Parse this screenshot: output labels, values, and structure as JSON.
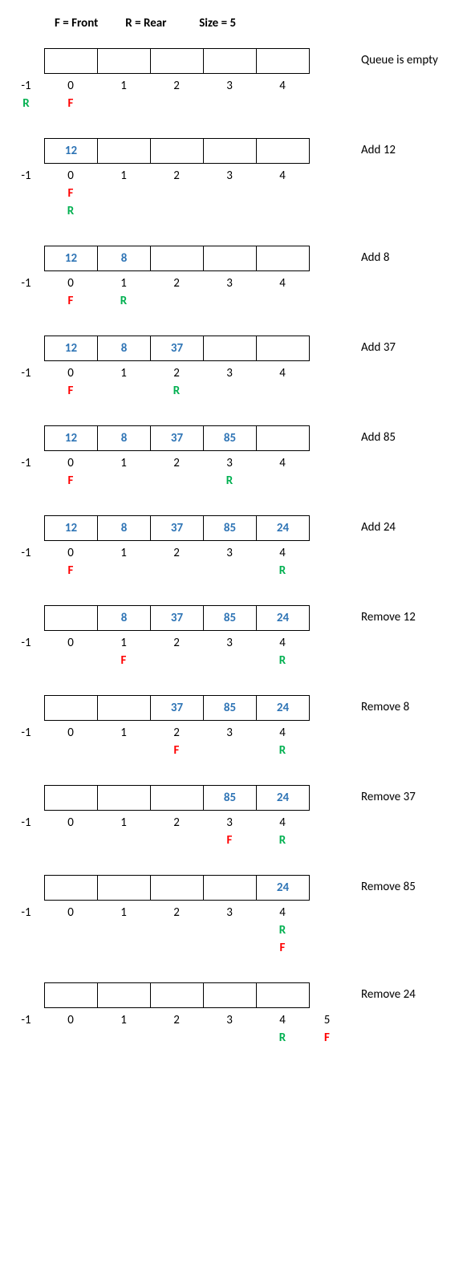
{
  "legend": {
    "front": "F = Front",
    "rear": "R = Rear",
    "size": "Size = 5"
  },
  "pre_index": "-1",
  "post_index": "5",
  "indices": [
    "0",
    "1",
    "2",
    "3",
    "4"
  ],
  "F": "F",
  "R": "R",
  "states": [
    {
      "caption": "Queue is empty",
      "cells": [
        "",
        "",
        "",
        "",
        ""
      ],
      "ptrRows": [
        {
          "pre": "R",
          "cols": [
            "F",
            "",
            "",
            "",
            ""
          ],
          "post": ""
        }
      ]
    },
    {
      "caption": "Add 12",
      "cells": [
        "12",
        "",
        "",
        "",
        ""
      ],
      "ptrRows": [
        {
          "pre": "",
          "cols": [
            "F",
            "",
            "",
            "",
            ""
          ],
          "post": ""
        },
        {
          "pre": "",
          "cols": [
            "R",
            "",
            "",
            "",
            ""
          ],
          "post": ""
        }
      ]
    },
    {
      "caption": "Add 8",
      "cells": [
        "12",
        "8",
        "",
        "",
        ""
      ],
      "ptrRows": [
        {
          "pre": "",
          "cols": [
            "F",
            "R",
            "",
            "",
            ""
          ],
          "post": ""
        }
      ]
    },
    {
      "caption": "Add 37",
      "cells": [
        "12",
        "8",
        "37",
        "",
        ""
      ],
      "ptrRows": [
        {
          "pre": "",
          "cols": [
            "F",
            "",
            "R",
            "",
            ""
          ],
          "post": ""
        }
      ]
    },
    {
      "caption": "Add 85",
      "cells": [
        "12",
        "8",
        "37",
        "85",
        ""
      ],
      "ptrRows": [
        {
          "pre": "",
          "cols": [
            "F",
            "",
            "",
            "R",
            ""
          ],
          "post": ""
        }
      ]
    },
    {
      "caption": "Add 24",
      "cells": [
        "12",
        "8",
        "37",
        "85",
        "24"
      ],
      "ptrRows": [
        {
          "pre": "",
          "cols": [
            "F",
            "",
            "",
            "",
            "R"
          ],
          "post": ""
        }
      ]
    },
    {
      "caption": "Remove 12",
      "cells": [
        "",
        "8",
        "37",
        "85",
        "24"
      ],
      "ptrRows": [
        {
          "pre": "",
          "cols": [
            "",
            "F",
            "",
            "",
            "R"
          ],
          "post": ""
        }
      ]
    },
    {
      "caption": "Remove 8",
      "cells": [
        "",
        "",
        "37",
        "85",
        "24"
      ],
      "ptrRows": [
        {
          "pre": "",
          "cols": [
            "",
            "",
            "F",
            "",
            "R"
          ],
          "post": ""
        }
      ]
    },
    {
      "caption": "Remove 37",
      "cells": [
        "",
        "",
        "",
        "85",
        "24"
      ],
      "ptrRows": [
        {
          "pre": "",
          "cols": [
            "",
            "",
            "",
            "F",
            "R"
          ],
          "post": ""
        }
      ]
    },
    {
      "caption": "Remove 85",
      "cells": [
        "",
        "",
        "",
        "",
        "24"
      ],
      "ptrRows": [
        {
          "pre": "",
          "cols": [
            "",
            "",
            "",
            "",
            "R"
          ],
          "post": ""
        },
        {
          "pre": "",
          "cols": [
            "",
            "",
            "",
            "",
            "F"
          ],
          "post": ""
        }
      ]
    },
    {
      "caption": "Remove 24",
      "cells": [
        "",
        "",
        "",
        "",
        ""
      ],
      "showPost": true,
      "ptrRows": [
        {
          "pre": "",
          "cols": [
            "",
            "",
            "",
            "",
            "R"
          ],
          "post": "F"
        }
      ]
    }
  ]
}
